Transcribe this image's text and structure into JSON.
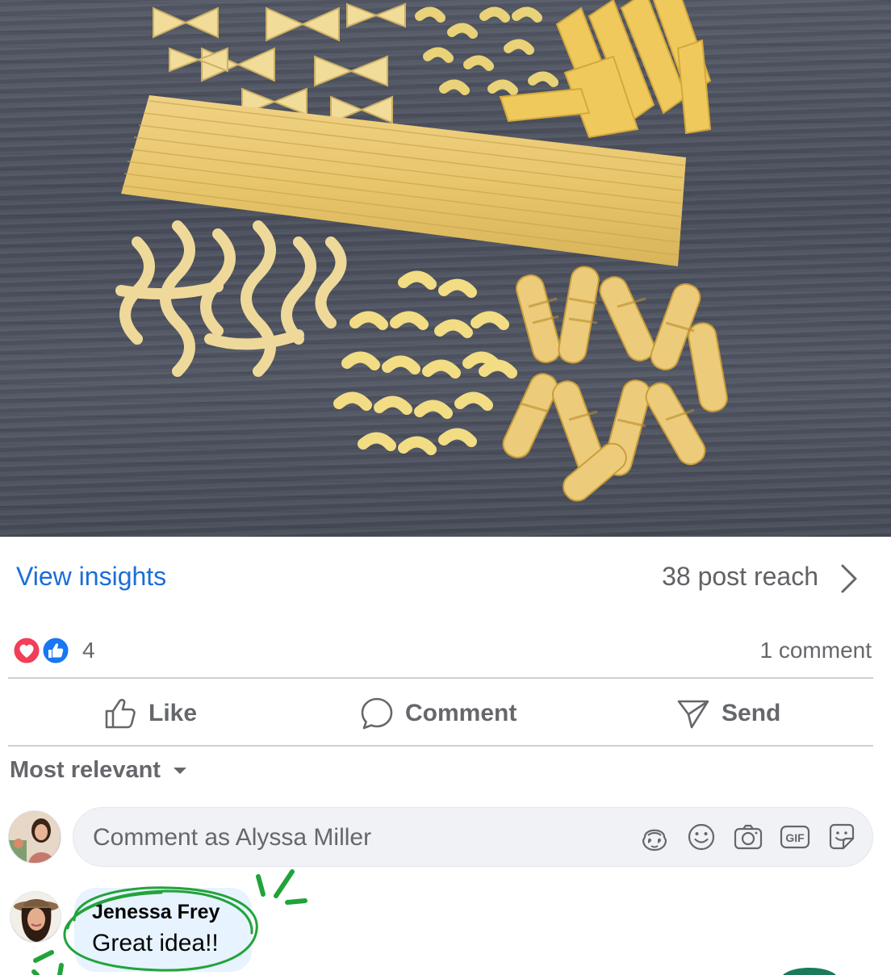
{
  "post": {
    "photo_alt": "",
    "insights_link": "View insights",
    "reach_text": "38 post reach"
  },
  "reactions": {
    "count": "4",
    "types": [
      "love",
      "like"
    ],
    "comment_count": "1 comment"
  },
  "actions": {
    "like": "Like",
    "comment": "Comment",
    "send": "Send"
  },
  "comments": {
    "sort_label": "Most relevant",
    "composer_placeholder": "Comment as Alyssa Miller",
    "composer_icons": [
      "avatar-sticker-icon",
      "emoji-icon",
      "camera-icon",
      "gif-icon",
      "sticker-icon"
    ],
    "items": [
      {
        "author": "Jenessa Frey",
        "text": "Great idea!!"
      }
    ]
  },
  "colors": {
    "link": "#1a6ed8",
    "muted": "#65676b",
    "highlight_green": "#22a33a",
    "bubble": "#e7f3ff"
  }
}
